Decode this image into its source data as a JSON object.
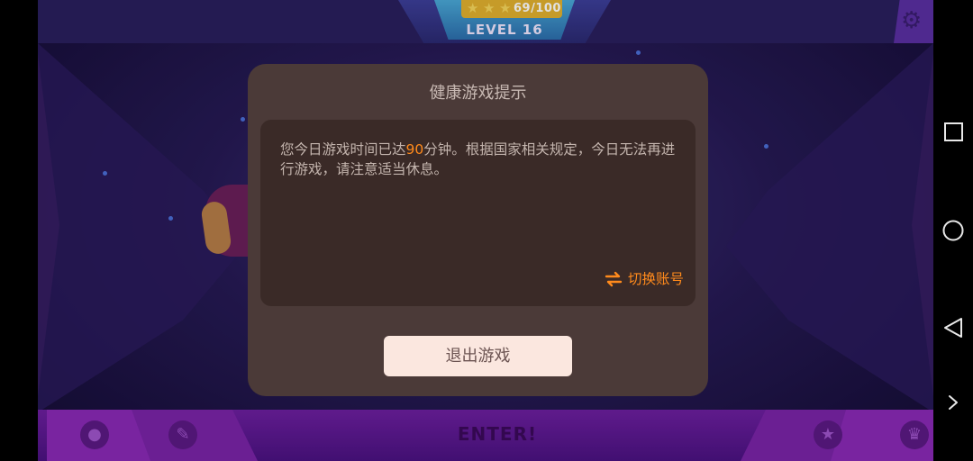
{
  "game": {
    "progress_text": "69/100",
    "level_text": "LEVEL 16",
    "enter_text": "ENTER!",
    "icons": [
      "settings-gear-icon",
      "profile-icon",
      "feather-icon",
      "star-icon",
      "trophy-icon"
    ]
  },
  "dialog": {
    "title": "健康游戏提示",
    "message_part1": "您今日游戏时间已达",
    "message_highlight": "90",
    "message_part2": "分钟。根据国家相关规定，今日无法再进行游戏，请注意适当休息。",
    "switch_label": "切换账号",
    "switch_icon": "swap-icon",
    "exit_button": "退出游戏"
  },
  "colors": {
    "dialog_bg": "#4b3a38",
    "message_bg": "#3a2a27",
    "accent_orange": "#ff8a1c",
    "button_bg": "#fbe7df"
  },
  "navbar": {
    "icons": [
      "recents-square-icon",
      "home-circle-icon",
      "back-triangle-icon",
      "expand-chevron-icon"
    ]
  }
}
